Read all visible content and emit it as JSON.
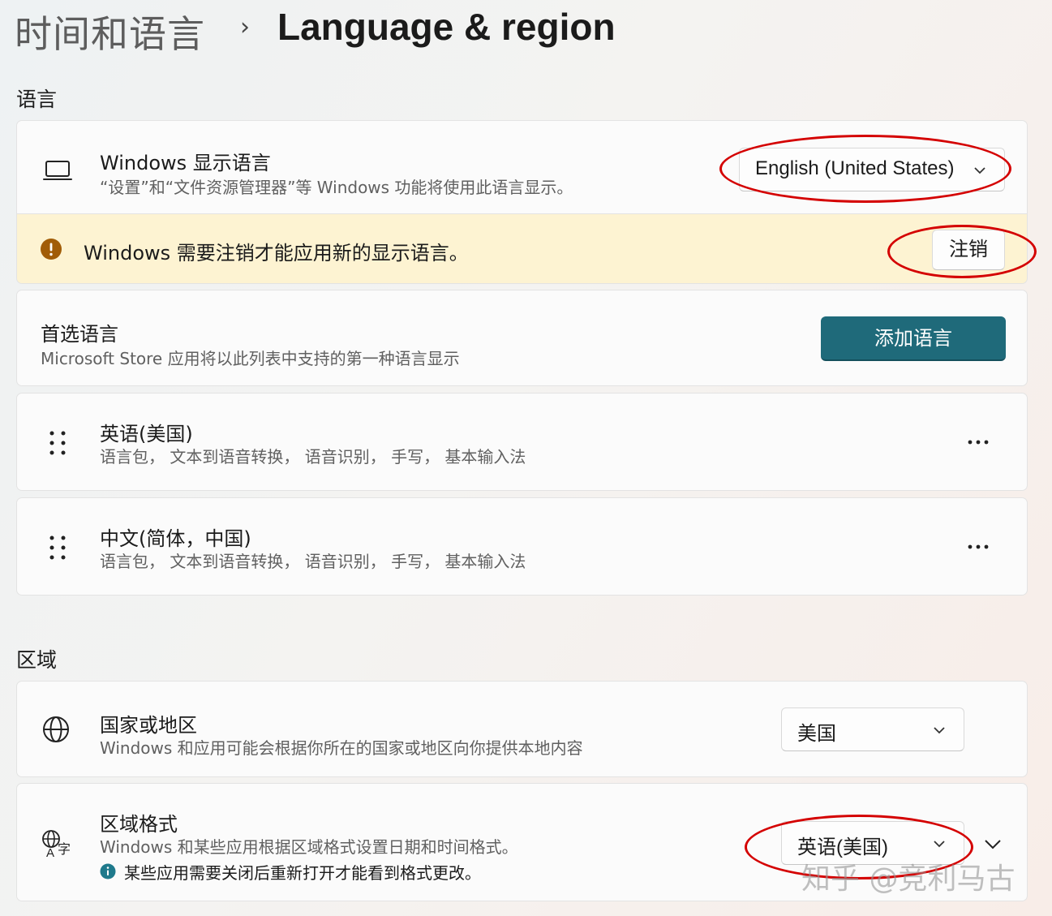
{
  "breadcrumb": {
    "parent": "时间和语言",
    "separator": "›",
    "current": "Language & region"
  },
  "language_section": {
    "header": "语言",
    "display_language": {
      "title": "Windows 显示语言",
      "description": "“设置”和“文件资源管理器”等 Windows 功能将使用此语言显示。",
      "selected": "English (United States)",
      "icon": "laptop-icon"
    },
    "signout_banner": {
      "text": "Windows 需要注销才能应用新的显示语言。",
      "button": "注销",
      "icon": "warning-icon",
      "bg_color": "#fdf3d2",
      "icon_color": "#a15c07"
    },
    "preferred": {
      "title": "首选语言",
      "description": "Microsoft Store 应用将以此列表中支持的第一种语言显示",
      "add_button": "添加语言",
      "accent_color": "#1f6a7a"
    },
    "languages": [
      {
        "name": "英语(美国)",
        "features": "语言包， 文本到语音转换， 语音识别， 手写， 基本输入法"
      },
      {
        "name": "中文(简体，中国)",
        "features": "语言包， 文本到语音转换， 语音识别， 手写， 基本输入法"
      }
    ]
  },
  "region_section": {
    "header": "区域",
    "country": {
      "title": "国家或地区",
      "description": "Windows 和应用可能会根据你所在的国家或地区向你提供本地内容",
      "selected": "美国",
      "icon": "globe-icon"
    },
    "regional_format": {
      "title": "区域格式",
      "description": "Windows 和某些应用根据区域格式设置日期和时间格式。",
      "notice": "某些应用需要关闭后重新打开才能看到格式更改。",
      "selected": "英语(美国)",
      "icon": "regional-format-icon",
      "info_color": "#1f7a8c"
    }
  },
  "annotation_color": "#d40000",
  "watermark": "知乎 @竞利马古"
}
